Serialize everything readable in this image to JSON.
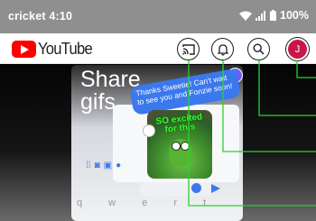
{
  "status_bar": {
    "carrier_time": "cricket 4:10",
    "battery": "100%"
  },
  "app_bar": {
    "logo_text": "YouTube",
    "avatar_initial": "J",
    "actions": [
      "cast-icon",
      "notifications-icon",
      "search-icon",
      "account-avatar"
    ]
  },
  "video": {
    "title_line1": "Share",
    "title_line2": "gifs",
    "message_bubble": "Thanks Sweetie! Can't wait to see you and Fonzie soon!",
    "gif_caption_line1": "SO excited",
    "gif_caption_line2": "for this",
    "keyboard_hint": "q w e r t"
  },
  "colors": {
    "youtube_red": "#ff0000",
    "callout_green": "#2bd12f",
    "avatar_bg": "#c7174a",
    "messenger_blue": "#3a78ee"
  }
}
